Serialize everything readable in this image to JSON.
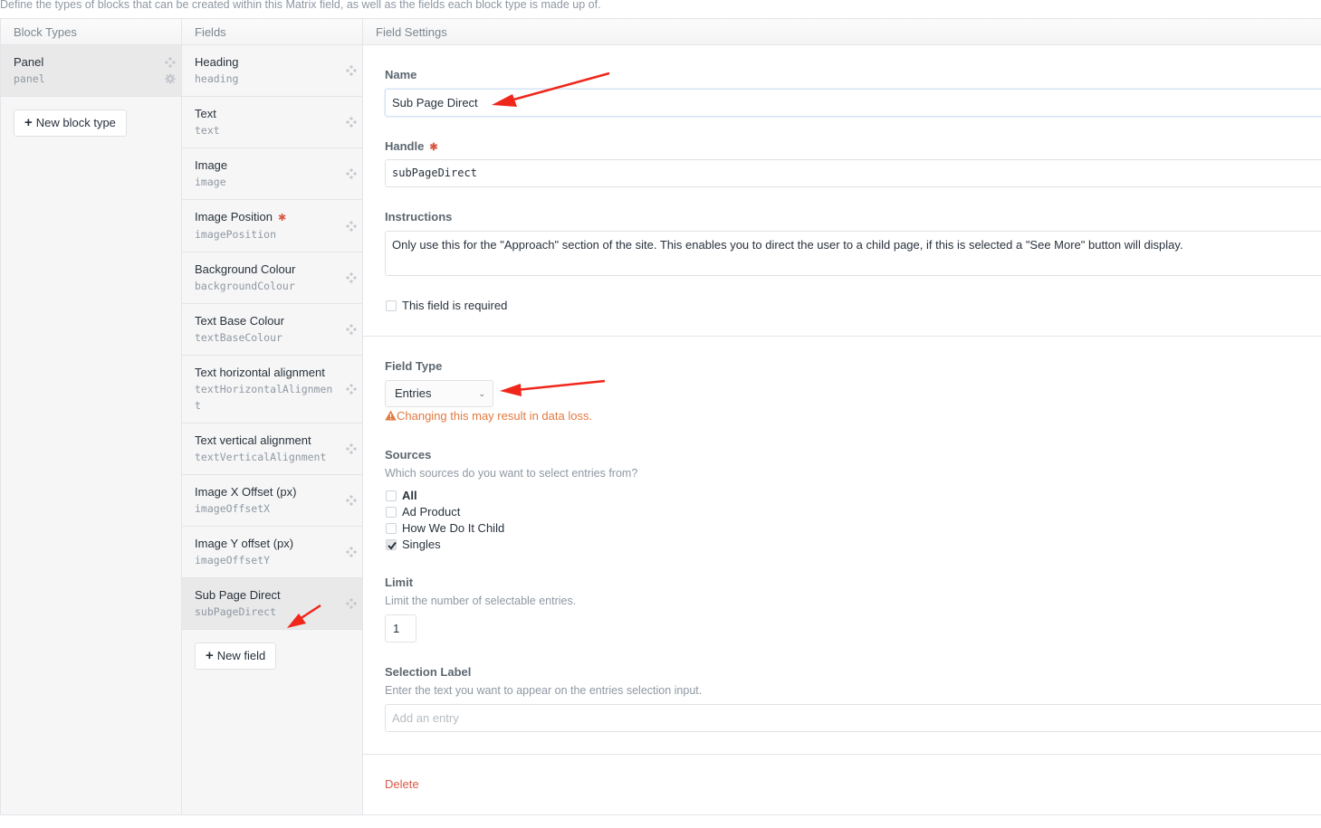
{
  "intro_text": "Define the types of blocks that can be created within this Matrix field, as well as the fields each block type is made up of.",
  "columns": {
    "block_types": "Block Types",
    "fields": "Fields",
    "field_settings": "Field Settings"
  },
  "block_types": [
    {
      "label": "Panel",
      "handle": "panel",
      "selected": true
    }
  ],
  "new_block_type_label": "New block type",
  "fields": [
    {
      "label": "Heading",
      "handle": "heading",
      "required": false,
      "selected": false
    },
    {
      "label": "Text",
      "handle": "text",
      "required": false,
      "selected": false
    },
    {
      "label": "Image",
      "handle": "image",
      "required": false,
      "selected": false
    },
    {
      "label": "Image Position",
      "handle": "imagePosition",
      "required": true,
      "selected": false
    },
    {
      "label": "Background Colour",
      "handle": "backgroundColour",
      "required": false,
      "selected": false
    },
    {
      "label": "Text Base Colour",
      "handle": "textBaseColour",
      "required": false,
      "selected": false
    },
    {
      "label": "Text horizontal alignment",
      "handle": "textHorizontalAlignment",
      "required": false,
      "selected": false
    },
    {
      "label": "Text vertical alignment",
      "handle": "textVerticalAlignment",
      "required": false,
      "selected": false
    },
    {
      "label": "Image X Offset (px)",
      "handle": "imageOffsetX",
      "required": false,
      "selected": false
    },
    {
      "label": "Image Y offset (px)",
      "handle": "imageOffsetY",
      "required": false,
      "selected": false
    },
    {
      "label": "Sub Page Direct",
      "handle": "subPageDirect",
      "required": false,
      "selected": true
    }
  ],
  "new_field_label": "New field",
  "settings": {
    "name_label": "Name",
    "name_value": "Sub Page Direct",
    "handle_label": "Handle",
    "handle_value": "subPageDirect",
    "instructions_label": "Instructions",
    "instructions_value": "Only use this for the \"Approach\" section of the site. This enables you to direct the user to a child page, if this is selected a \"See More\" button will display.",
    "required_label": "This field is required",
    "required_checked": false,
    "field_type_label": "Field Type",
    "field_type_value": "Entries",
    "field_type_warning": "Changing this may result in data loss.",
    "sources_label": "Sources",
    "sources_instructions": "Which sources do you want to select entries from?",
    "sources": [
      {
        "label": "All",
        "checked": false,
        "bold": true
      },
      {
        "label": "Ad Product",
        "checked": false,
        "bold": false
      },
      {
        "label": "How We Do It Child",
        "checked": false,
        "bold": false
      },
      {
        "label": "Singles",
        "checked": true,
        "bold": false
      }
    ],
    "limit_label": "Limit",
    "limit_instructions": "Limit the number of selectable entries.",
    "limit_value": "1",
    "selection_label_label": "Selection Label",
    "selection_label_instructions": "Enter the text you want to appear on the entries selection input.",
    "selection_label_placeholder": "Add an entry",
    "delete_label": "Delete"
  },
  "colors": {
    "required_star": "#da5a47",
    "warning": "#e27a41",
    "delete": "#da5a47",
    "annotation_arrow": "#f0261b"
  }
}
